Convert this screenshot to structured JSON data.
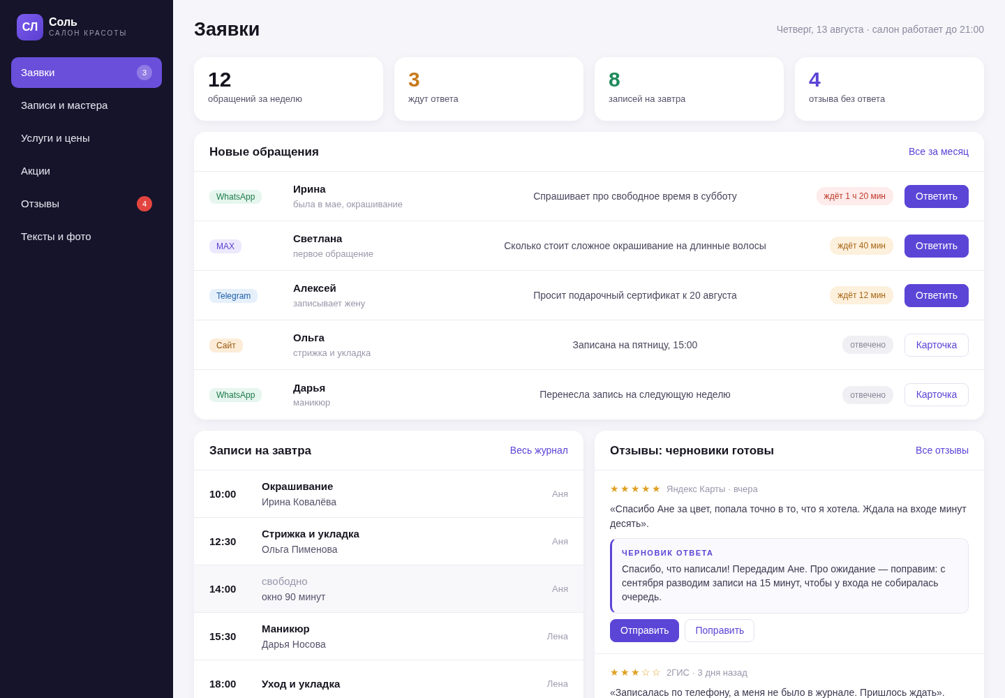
{
  "sidebar": {
    "logo": "СЛ",
    "brand": "Соль",
    "subtitle": "САЛОН КРАСОТЫ",
    "items": [
      {
        "label": "Заявки",
        "selected": true,
        "badge": {
          "text": "3",
          "kind": "count"
        }
      },
      {
        "label": "Записи и мастера",
        "selected": false
      },
      {
        "label": "Услуги и цены",
        "selected": false
      },
      {
        "label": "Акции",
        "selected": false
      },
      {
        "label": "Отзывы",
        "selected": false,
        "badge": {
          "text": "4",
          "kind": "alert"
        }
      },
      {
        "label": "Тексты и фото",
        "selected": false
      }
    ]
  },
  "header": {
    "title": "Заявки",
    "subtitle": "Четверг, 13 августа · салон работает до 21:00"
  },
  "stats": [
    {
      "value": "12",
      "label": "обращений за неделю",
      "color": "#16141f"
    },
    {
      "value": "3",
      "label": "ждут ответа",
      "color": "#c77a1c"
    },
    {
      "value": "8",
      "label": "записей на завтра",
      "color": "#1f8a5b"
    },
    {
      "value": "4",
      "label": "отзыва без ответа",
      "color": "#5b45d6"
    }
  ],
  "requests": {
    "title": "Новые обращения",
    "link": "Все за месяц",
    "rows": [
      {
        "channel": {
          "text": "WhatsApp",
          "kind": "whatsapp"
        },
        "name": "Ирина",
        "note": "была в мае, окрашивание",
        "message": "Спрашивает про свободное время в субботу",
        "status": {
          "text": "ждёт 1 ч 20 мин",
          "kind": "late"
        },
        "action": {
          "text": "Ответить",
          "kind": "primary"
        }
      },
      {
        "channel": {
          "text": "MAX",
          "kind": "max"
        },
        "name": "Светлана",
        "note": "первое обращение",
        "message": "Сколько стоит сложное окрашивание на длинные волосы",
        "status": {
          "text": "ждёт 40 мин",
          "kind": "waiting"
        },
        "action": {
          "text": "Ответить",
          "kind": "primary"
        }
      },
      {
        "channel": {
          "text": "Telegram",
          "kind": "telegram"
        },
        "name": "Алексей",
        "note": "записывает жену",
        "message": "Просит подарочный сертификат к 20 августа",
        "status": {
          "text": "ждёт 12 мин",
          "kind": "waiting"
        },
        "action": {
          "text": "Ответить",
          "kind": "primary"
        }
      },
      {
        "channel": {
          "text": "Сайт",
          "kind": "site"
        },
        "name": "Ольга",
        "note": "стрижка и укладка",
        "message": "Записана на пятницу, 15:00",
        "status": {
          "text": "отвечено",
          "kind": "done"
        },
        "action": {
          "text": "Карточка",
          "kind": "outline"
        }
      },
      {
        "channel": {
          "text": "WhatsApp",
          "kind": "whatsapp"
        },
        "name": "Дарья",
        "note": "маникюр",
        "message": "Перенесла запись на следующую неделю",
        "status": {
          "text": "отвечено",
          "kind": "done"
        },
        "action": {
          "text": "Карточка",
          "kind": "outline"
        }
      }
    ]
  },
  "appointments": {
    "title": "Записи на завтра",
    "link": "Весь журнал",
    "rows": [
      {
        "kind": "booked",
        "time": "10:00",
        "title": "Окрашивание",
        "client": "Ирина Ковалёва",
        "master": "Аня"
      },
      {
        "kind": "booked",
        "time": "12:30",
        "title": "Стрижка и укладка",
        "client": "Ольга Пименова",
        "master": "Аня"
      },
      {
        "kind": "free",
        "time": "14:00",
        "title": "свободно",
        "client": "окно 90 минут",
        "master": "Аня"
      },
      {
        "kind": "booked",
        "time": "15:30",
        "title": "Маникюр",
        "client": "Дарья Носова",
        "master": "Лена"
      },
      {
        "kind": "booked",
        "time": "18:00",
        "title": "Уход и укладка",
        "master": "Лена"
      }
    ]
  },
  "reviews": {
    "title": "Отзывы: черновики готовы",
    "link": "Все отзывы",
    "items": [
      {
        "stars": 5,
        "source": "Яндекс Карты · вчера",
        "text": "«Спасибо Ане за цвет, попала точно в то, что я хотела. Ждала на входе минут десять».",
        "draft": {
          "label": "ЧЕРНОВИК ОТВЕТА",
          "text": "Спасибо, что написали! Передадим Ане. Про ожидание — поправим: с сентября разводим записи на 15 минут, чтобы у входа не собиралась очередь."
        },
        "buttons": [
          {
            "text": "Отправить",
            "kind": "primary"
          },
          {
            "text": "Поправить",
            "kind": "outline"
          }
        ]
      },
      {
        "stars": 3,
        "source": "2ГИС · 3 дня назад",
        "text": "«Записалась по телефону, а меня не было в журнале. Пришлось ждать»."
      }
    ]
  }
}
